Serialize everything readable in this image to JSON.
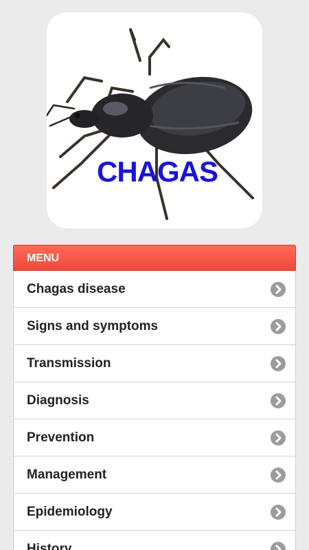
{
  "hero": {
    "title": "CHAGAS",
    "image_icon": "kissing-bug-icon"
  },
  "menu": {
    "header_label": "MENU",
    "chevron_icon": "chevron-right-icon",
    "items": [
      {
        "label": "Chagas disease"
      },
      {
        "label": "Signs and symptoms"
      },
      {
        "label": "Transmission"
      },
      {
        "label": "Diagnosis"
      },
      {
        "label": "Prevention"
      },
      {
        "label": "Management"
      },
      {
        "label": "Epidemiology"
      },
      {
        "label": "History"
      }
    ]
  },
  "colors": {
    "background": "#ebebeb",
    "menu_header": "#f1483a",
    "title_text": "#1a14d8",
    "chevron": "#9c9c9c"
  }
}
